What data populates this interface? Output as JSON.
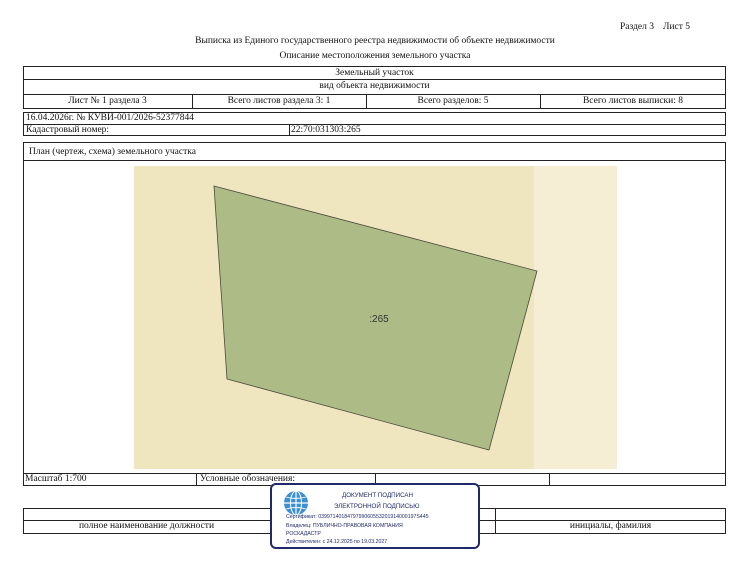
{
  "header": {
    "section_label": "Раздел 3",
    "sheet_label": "Лист 5",
    "title": "Выписка из Единого государственного реестра недвижимости об объекте недвижимости",
    "subtitle": "Описание местоположения земельного участка"
  },
  "object": {
    "type": "Земельный участок",
    "kind": "вид объекта недвижимости"
  },
  "info_row": {
    "sheet_of_section": "Лист № 1 раздела 3",
    "sheets_in_section": "Всего листов раздела 3: 1",
    "sections_total": "Всего разделов: 5",
    "sheets_total": "Всего листов выписки: 8"
  },
  "doc": {
    "date_number": "16.04.2026г. № КУВИ-001/2026-52377844",
    "cadastral_label": "Кадастровый номер:",
    "cadastral_value": "22:70:031303:265"
  },
  "plan": {
    "heading": "План (чертеж, схема) земельного участка",
    "parcel_label": ":265",
    "parcel_fill": "#adbb86",
    "background_fill": "#efe6c0",
    "background_fill_light": "#f5eed5"
  },
  "footer": {
    "scale": "Масштаб 1:700",
    "legend": "Условные обозначения:",
    "position_label": "полное наименование должности",
    "initials_label": "инициалы, фамилия"
  },
  "stamp": {
    "line1": "ДОКУМЕНТ ПОДПИСАН",
    "line2": "ЭЛЕКТРОННОЙ ПОДПИСЬЮ",
    "certificate": "Сертификат: 0399714018479799060553201914000197S445",
    "owner": "Владелец: ПУБЛИЧНО-ПРАВОВАЯ КОМПАНИЯ",
    "owner2": "РОСКАДАСТР",
    "valid": "Действителен: с 24.12.2025 по 19.03.2027",
    "icon": "globe-icon",
    "color": "#1f2a6b"
  }
}
